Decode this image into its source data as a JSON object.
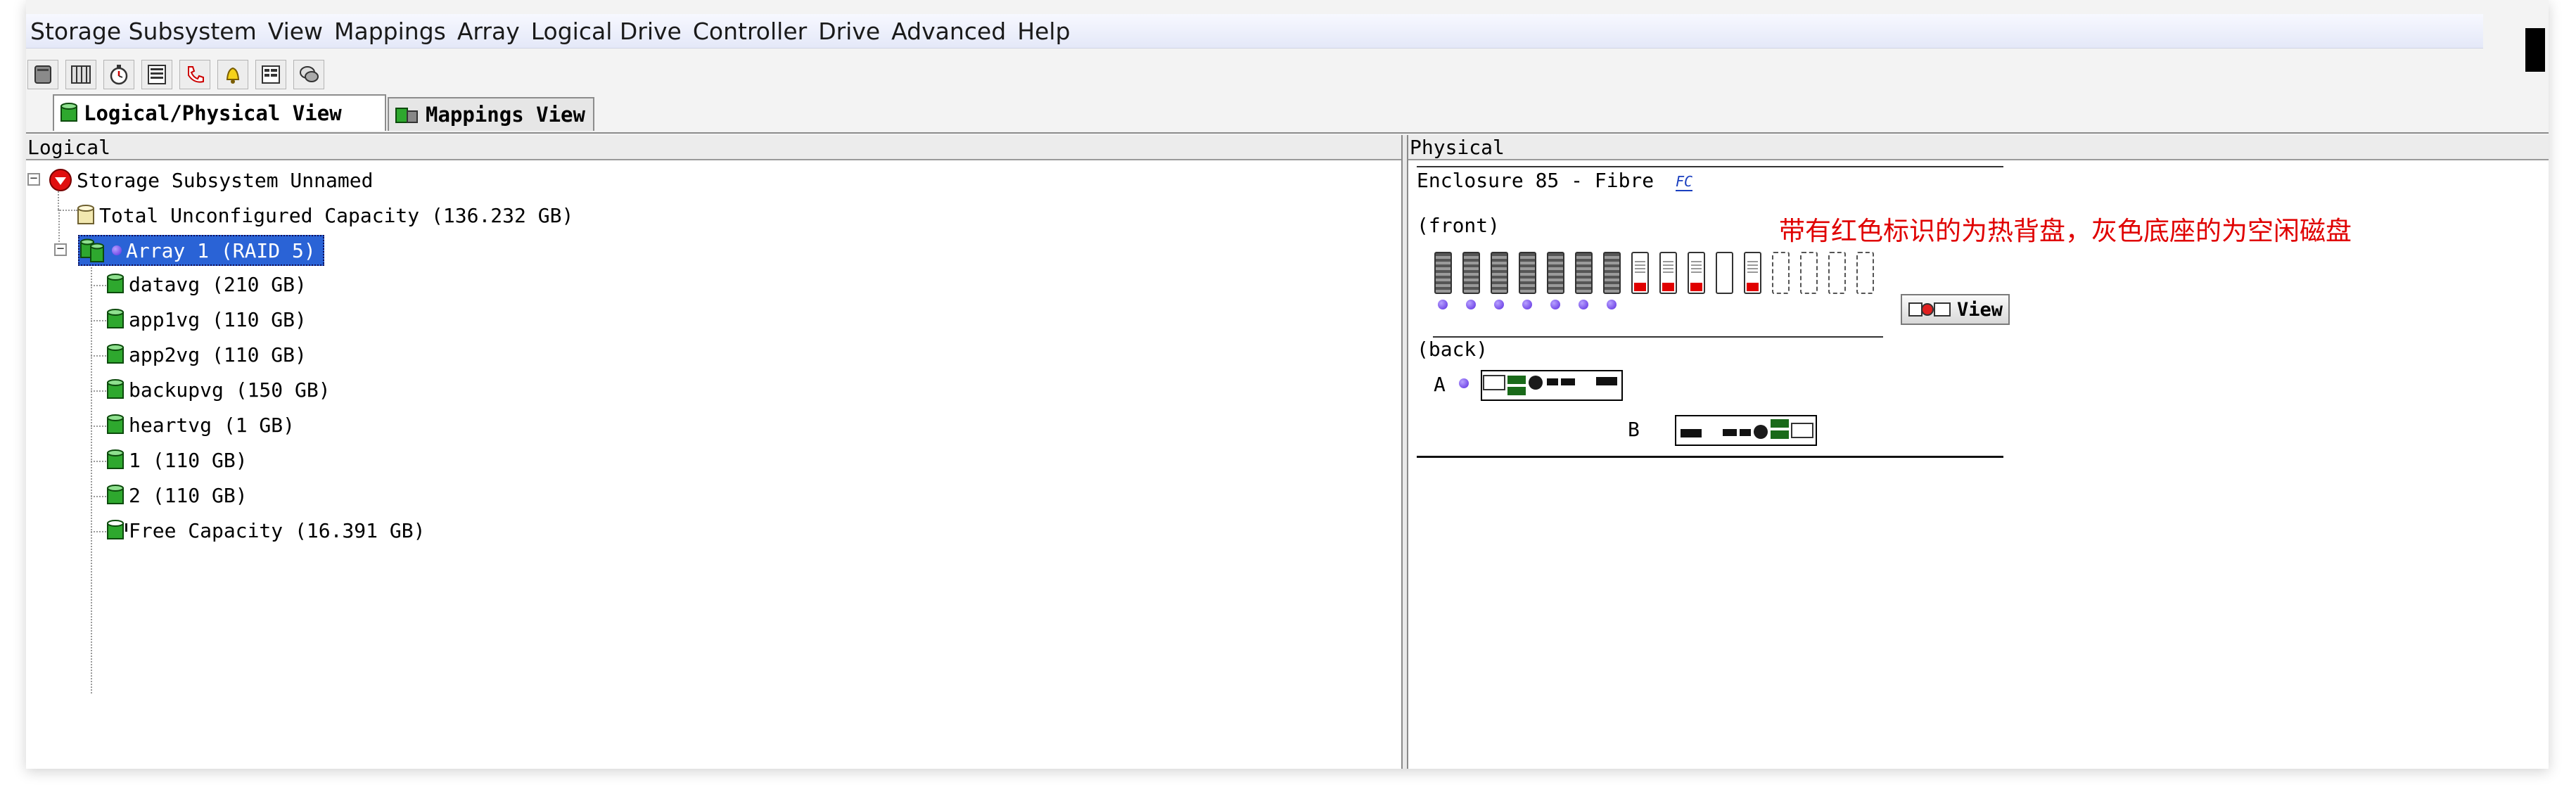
{
  "menu": [
    "Storage Subsystem",
    "View",
    "Mappings",
    "Array",
    "Logical Drive",
    "Controller",
    "Drive",
    "Advanced",
    "Help"
  ],
  "toolbar": {
    "icons": [
      "subsystem-icon",
      "enclosure-icon",
      "stopwatch-icon",
      "list-icon",
      "phone-icon",
      "bell-icon",
      "properties-icon",
      "chat-icon"
    ]
  },
  "tabs": {
    "logical_physical": "Logical/Physical View",
    "mappings": "Mappings View"
  },
  "logical": {
    "header": "Logical",
    "root": "Storage Subsystem Unnamed",
    "unconfigured": "Total Unconfigured Capacity (136.232 GB)",
    "array": "Array 1 (RAID 5)",
    "drives": [
      "datavg (210 GB)",
      "app1vg (110 GB)",
      "app2vg (110 GB)",
      "backupvg (150 GB)",
      "heartvg (1 GB)",
      "1 (110 GB)",
      "2 (110 GB)"
    ],
    "free": "Free Capacity (16.391 GB)"
  },
  "physical": {
    "header": "Physical",
    "enclosure": "Enclosure 85 - Fibre",
    "fc_badge": "FC",
    "front": "(front)",
    "back": "(back)",
    "annotation": "带有红色标识的为热背盘，灰色底座的为空闲磁盘",
    "view_button": "View",
    "controller_a": "A",
    "controller_b": "B",
    "slots": [
      "used",
      "used",
      "used",
      "used",
      "used",
      "used",
      "used",
      "hotspare",
      "hotspare",
      "hotspare",
      "used",
      "hotspare",
      "empty",
      "empty",
      "empty",
      "empty"
    ],
    "colors": {
      "hotspare_marker": "#e00000",
      "annotation": "#e00000",
      "selection": "#2a63d6"
    }
  }
}
